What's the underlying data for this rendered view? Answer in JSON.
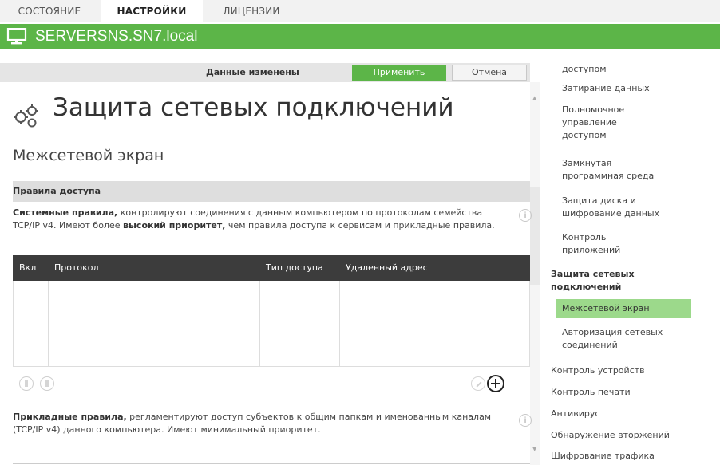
{
  "tabs": [
    {
      "label": "СОСТОЯНИЕ",
      "active": false
    },
    {
      "label": "НАСТРОЙКИ",
      "active": true
    },
    {
      "label": "ЛИЦЕНЗИИ",
      "active": false
    }
  ],
  "host": {
    "name": "SERVERSNS.SN7.local",
    "icon": "computer-monitor-icon"
  },
  "actionbar": {
    "changed_text": "Данные изменены",
    "apply_label": "Применить",
    "cancel_label": "Отмена"
  },
  "page": {
    "title": "Защита сетевых подключений",
    "title_icon": "gear-icon",
    "subtitle": "Межсетевой экран"
  },
  "access_rules": {
    "header": "Правила доступа",
    "system_rules": {
      "bold_lead": "Системные правила,",
      "text1": " контролируют соединения с данным компьютером по протоколам семейства TCP/IP v4. Имеют более ",
      "bold_mid": "высокий приоритет,",
      "text2": " чем правила доступа к сервисам и прикладные правила."
    },
    "table": {
      "columns": [
        "Вкл",
        "Протокол",
        "Тип доступа",
        "Удаленный адрес"
      ],
      "rows": []
    },
    "app_rules": {
      "bold_lead": "Прикладные правила,",
      "text": " регламентируют доступ субъектов к общим папкам и именованным каналам (TCP/IP v4) данного компьютера. Имеют минимальный приоритет."
    }
  },
  "nav": {
    "items": [
      {
        "label": "доступом",
        "level": 2,
        "state": "normal"
      },
      {
        "label": "Затирание данных",
        "level": 2,
        "state": "normal"
      },
      {
        "label": "Полномочное\nуправление\nдоступом",
        "level": 2,
        "state": "normal"
      },
      {
        "label": "Замкнутая\nпрограммная среда",
        "level": 2,
        "state": "normal"
      },
      {
        "label": "Защита диска и\nшифрование данных",
        "level": 2,
        "state": "normal"
      },
      {
        "label": "Контроль\nприложений",
        "level": 2,
        "state": "normal"
      },
      {
        "label": "Защита сетевых\nподключений",
        "level": 1,
        "state": "bold"
      },
      {
        "label": "Межсетевой экран",
        "level": 2,
        "state": "active"
      },
      {
        "label": "Авторизация сетевых\nсоединений",
        "level": 2,
        "state": "normal"
      },
      {
        "label": "Контроль устройств",
        "level": 1,
        "state": "normal"
      },
      {
        "label": "Контроль печати",
        "level": 1,
        "state": "normal"
      },
      {
        "label": "Антивирус",
        "level": 1,
        "state": "normal"
      },
      {
        "label": "Обнаружение вторжений",
        "level": 1,
        "state": "normal"
      },
      {
        "label": "Шифрование трафика",
        "level": 1,
        "state": "normal"
      }
    ]
  },
  "colors": {
    "accent_green": "#5cb548",
    "nav_active": "#9cd98b",
    "table_header": "#3c3c3c"
  }
}
